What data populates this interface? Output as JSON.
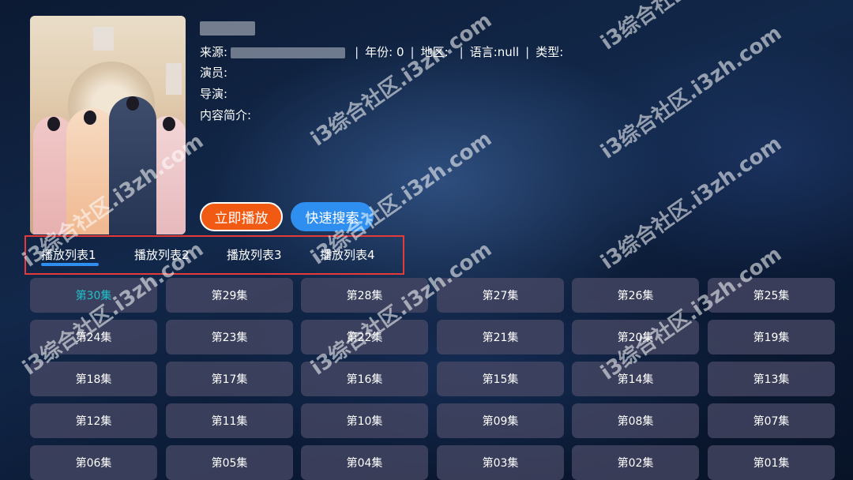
{
  "meta": {
    "source_label": "来源:",
    "year_label": "年份:",
    "year_value": "0",
    "region_label": "地区:",
    "language_label": "语言:",
    "language_value": "null",
    "type_label": "类型:",
    "actors_label": "演员:",
    "director_label": "导演:",
    "intro_label": "内容简介:"
  },
  "actions": {
    "play_label": "立即播放",
    "search_label": "快速搜索"
  },
  "tabs": [
    "播放列表1",
    "播放列表2",
    "播放列表3",
    "播放列表4"
  ],
  "episodes": [
    "第30集",
    "第29集",
    "第28集",
    "第27集",
    "第26集",
    "第25集",
    "第24集",
    "第23集",
    "第22集",
    "第21集",
    "第20集",
    "第19集",
    "第18集",
    "第17集",
    "第16集",
    "第15集",
    "第14集",
    "第13集",
    "第12集",
    "第11集",
    "第10集",
    "第09集",
    "第08集",
    "第07集",
    "第06集",
    "第05集",
    "第04集",
    "第03集",
    "第02集",
    "第01集"
  ],
  "watermark": "i3综合社区.i3zh.com",
  "colors": {
    "play_button": "#f15a13",
    "search_button": "#2e8ff0",
    "active_episode_text": "#1ec2c9",
    "highlight_border": "#e53a3a"
  }
}
